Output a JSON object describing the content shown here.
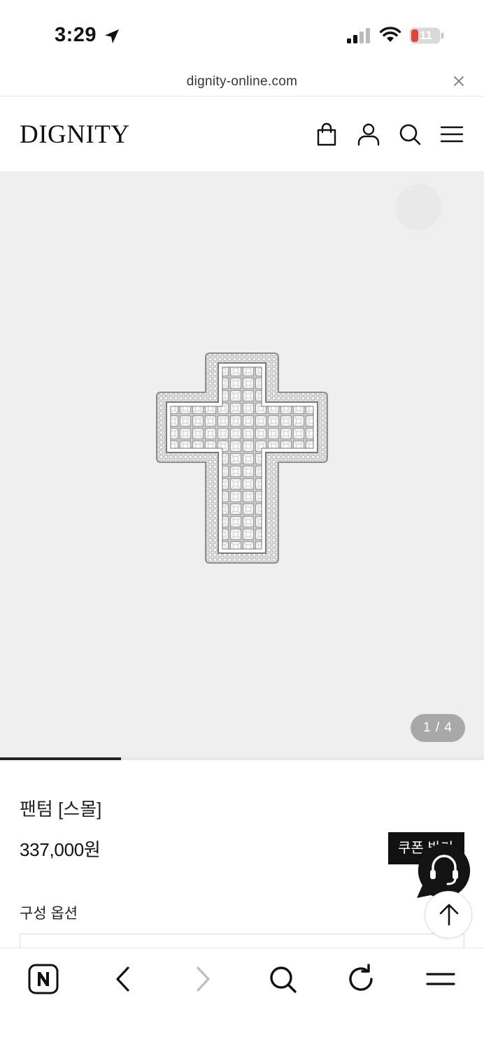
{
  "status_bar": {
    "time": "3:29",
    "battery": "11"
  },
  "browser": {
    "url": "dignity-online.com"
  },
  "header": {
    "logo": "DIGNITY",
    "icons": [
      "shopping-bag-icon",
      "user-icon",
      "search-icon",
      "menu-icon"
    ]
  },
  "gallery": {
    "counter": "1 / 4",
    "current": 1,
    "total": 4
  },
  "product": {
    "name": "팬텀 [스몰]",
    "price": "337,000원",
    "option_label": "구성 옵션"
  },
  "floating": {
    "coupon_label": "쿠폰 받기"
  },
  "toolbar": {
    "icons": [
      "naver-home-icon",
      "back-icon",
      "forward-icon",
      "search-icon",
      "reload-icon",
      "menu-icon"
    ]
  },
  "colors": {
    "accent": "#111111",
    "image_bg": "#efefef",
    "battery_low": "#e0453a"
  }
}
